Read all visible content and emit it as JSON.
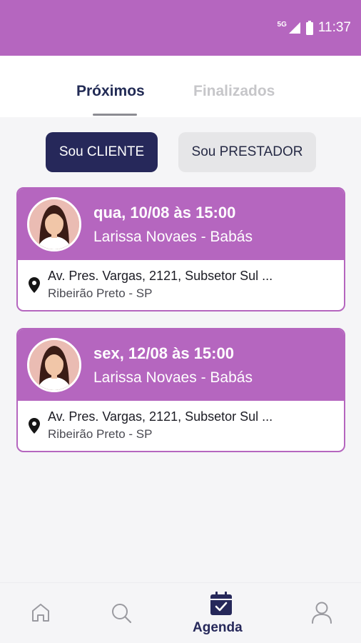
{
  "status_bar": {
    "network": "5G",
    "time": "11:37"
  },
  "tabs": [
    {
      "label": "Próximos",
      "active": true
    },
    {
      "label": "Finalizados",
      "active": false
    }
  ],
  "segment": {
    "client_label": "Sou CLIENTE",
    "provider_label": "Sou PRESTADOR",
    "selected": "client"
  },
  "appointments": [
    {
      "date": "qua, 10/08 às 15:00",
      "provider": "Larissa Novaes - Babás",
      "address_line1": "Av. Pres. Vargas, 2121, Subsetor Sul ...",
      "address_line2": "Ribeirão Preto - SP"
    },
    {
      "date": "sex, 12/08 às 15:00",
      "provider": "Larissa Novaes - Babás",
      "address_line1": "Av. Pres. Vargas, 2121, Subsetor Sul ...",
      "address_line2": "Ribeirão Preto - SP"
    }
  ],
  "bottom_nav": {
    "items": [
      {
        "icon": "home-icon",
        "label": ""
      },
      {
        "icon": "search-icon",
        "label": ""
      },
      {
        "icon": "calendar-icon",
        "label": "Agenda",
        "active": true
      },
      {
        "icon": "profile-icon",
        "label": ""
      }
    ]
  },
  "colors": {
    "brand": "#b566bf",
    "navy": "#26285a",
    "inactive": "#c6c6c9"
  }
}
